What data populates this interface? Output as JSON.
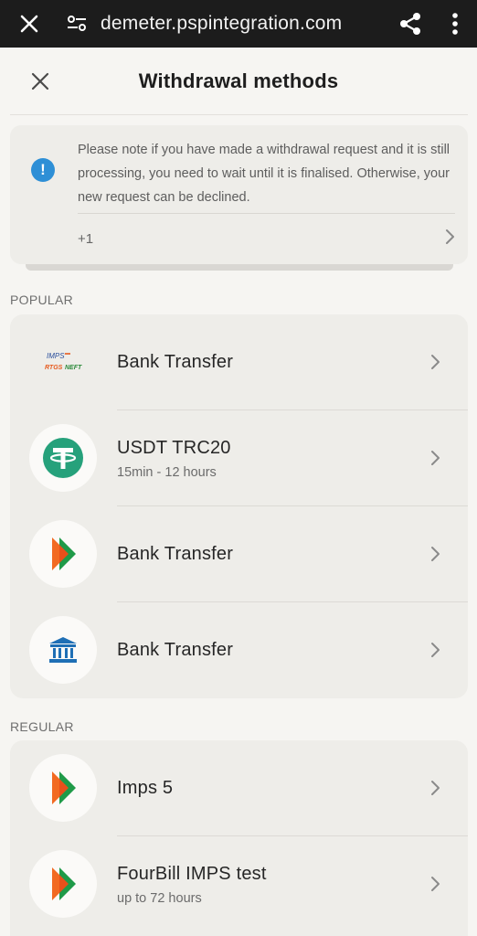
{
  "browser": {
    "url": "demeter.pspintegration.com",
    "close_icon": "close-icon",
    "site_settings_icon": "tune-icon",
    "share_icon": "share-icon",
    "more_icon": "more-vert-icon"
  },
  "header": {
    "title": "Withdrawal methods",
    "close_icon": "close-icon"
  },
  "notice": {
    "icon": "info-icon",
    "icon_glyph": "!",
    "text": "Please note if you have made a withdrawal request and it is still processing, you need to wait until it is finalised. Otherwise, your new request can be declined.",
    "more_label": "+1",
    "accent_color": "#2e8fd6"
  },
  "sections": {
    "popular": {
      "label": "POPULAR",
      "items": [
        {
          "title": "Bank Transfer",
          "subtitle": "",
          "logo": "imps-neft-logo"
        },
        {
          "title": "USDT TRC20",
          "subtitle": "15min - 12 hours",
          "logo": "tether-logo"
        },
        {
          "title": "Bank Transfer",
          "subtitle": "",
          "logo": "bhim-logo"
        },
        {
          "title": "Bank Transfer",
          "subtitle": "",
          "logo": "bank-building-icon"
        }
      ]
    },
    "regular": {
      "label": "REGULAR",
      "items": [
        {
          "title": "Imps 5",
          "subtitle": "",
          "logo": "bhim-logo"
        },
        {
          "title": "FourBill IMPS test",
          "subtitle": "up to 72 hours",
          "logo": "bhim-logo"
        }
      ]
    }
  },
  "colors": {
    "tether_green": "#26a17b",
    "bhim_orange": "#f26a22",
    "bhim_green": "#1f9a48",
    "bank_blue": "#1f6fb5"
  }
}
